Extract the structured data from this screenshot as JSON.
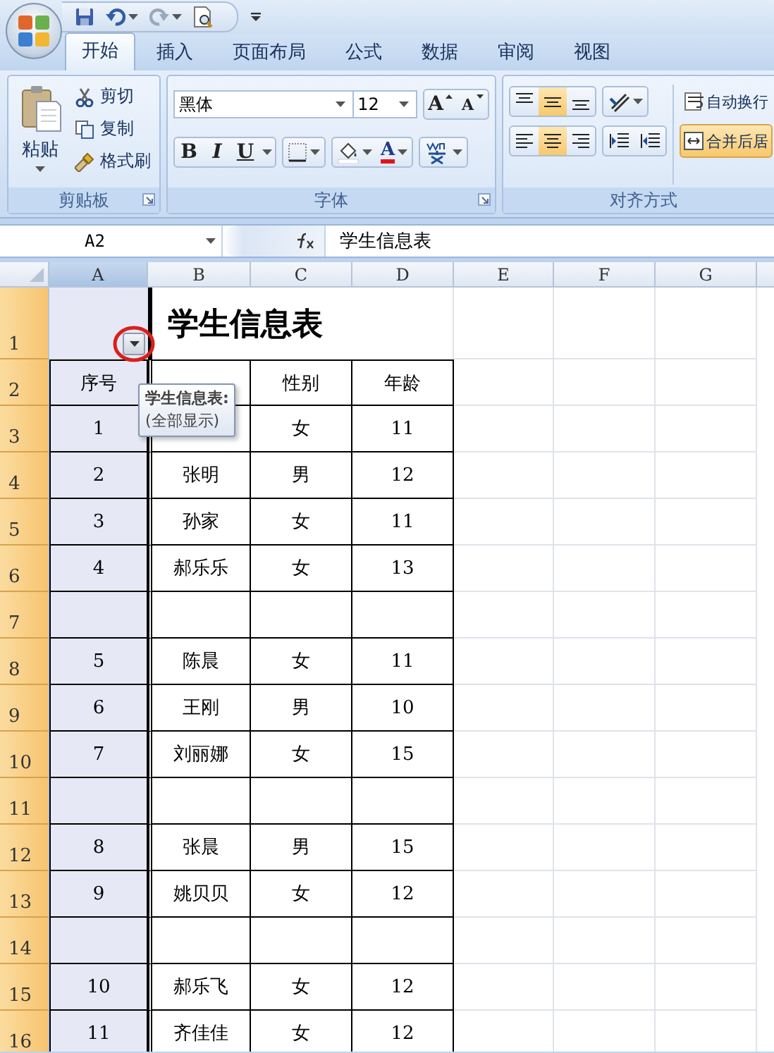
{
  "tabs": [
    {
      "label": "开始",
      "selected": true
    },
    {
      "label": "插入",
      "selected": false
    },
    {
      "label": "页面布局",
      "selected": false
    },
    {
      "label": "公式",
      "selected": false
    },
    {
      "label": "数据",
      "selected": false
    },
    {
      "label": "审阅",
      "selected": false
    },
    {
      "label": "视图",
      "selected": false
    }
  ],
  "clipboard": {
    "label": "剪贴板",
    "paste": "粘贴",
    "cut": "剪切",
    "copy": "复制",
    "format_painter": "格式刷"
  },
  "font": {
    "label": "字体",
    "font_name": "黑体",
    "font_size": "12",
    "grow": "A",
    "shrink": "A",
    "bold": "B",
    "italic": "I",
    "underline": "U",
    "font_color": "A"
  },
  "alignment": {
    "label": "对齐方式",
    "row1": [
      {
        "kind": "top",
        "selected": false
      },
      {
        "kind": "middle",
        "selected": true
      },
      {
        "kind": "bottom",
        "selected": false
      }
    ],
    "row2": [
      {
        "kind": "left",
        "selected": false
      },
      {
        "kind": "center",
        "selected": true
      },
      {
        "kind": "right",
        "selected": false
      }
    ],
    "wrap": {
      "label": "自动换行",
      "selected": false
    },
    "merge": {
      "label": "合并后居",
      "selected": true
    }
  },
  "name_box": "A2",
  "formula": "学生信息表",
  "columns": [
    {
      "label": "A",
      "selected": true
    },
    {
      "label": "B",
      "selected": false
    },
    {
      "label": "C",
      "selected": false
    },
    {
      "label": "D",
      "selected": false
    },
    {
      "label": "E",
      "selected": false
    },
    {
      "label": "F",
      "selected": false
    },
    {
      "label": "G",
      "selected": false
    }
  ],
  "rows": [
    {
      "number": "1",
      "selected": true,
      "kind": "title",
      "title": "学生信息表"
    },
    {
      "number": "2",
      "selected": true,
      "kind": "data",
      "cells": {
        "A": "序号",
        "C": "性别",
        "D": "年龄"
      }
    },
    {
      "number": "3",
      "selected": true,
      "kind": "data",
      "cells": {
        "A": "1",
        "C": "女",
        "D": "11"
      }
    },
    {
      "number": "4",
      "selected": true,
      "kind": "data",
      "cells": {
        "A": "2",
        "B": "张明",
        "C": "男",
        "D": "12"
      }
    },
    {
      "number": "5",
      "selected": true,
      "kind": "data",
      "cells": {
        "A": "3",
        "B": "孙家",
        "C": "女",
        "D": "11"
      }
    },
    {
      "number": "6",
      "selected": true,
      "kind": "data",
      "cells": {
        "A": "4",
        "B": "郝乐乐",
        "C": "女",
        "D": "13"
      }
    },
    {
      "number": "7",
      "selected": true,
      "kind": "data",
      "cells": {}
    },
    {
      "number": "8",
      "selected": true,
      "kind": "data",
      "cells": {
        "A": "5",
        "B": "陈晨",
        "C": "女",
        "D": "11"
      }
    },
    {
      "number": "9",
      "selected": true,
      "kind": "data",
      "cells": {
        "A": "6",
        "B": "王刚",
        "C": "男",
        "D": "10"
      }
    },
    {
      "number": "10",
      "selected": true,
      "kind": "data",
      "cells": {
        "A": "7",
        "B": "刘丽娜",
        "C": "女",
        "D": "15"
      }
    },
    {
      "number": "11",
      "selected": true,
      "kind": "data",
      "cells": {}
    },
    {
      "number": "12",
      "selected": true,
      "kind": "data",
      "cells": {
        "A": "8",
        "B": "张晨",
        "C": "男",
        "D": "15"
      }
    },
    {
      "number": "13",
      "selected": true,
      "kind": "data",
      "cells": {
        "A": "9",
        "B": "姚贝贝",
        "C": "女",
        "D": "12"
      }
    },
    {
      "number": "14",
      "selected": true,
      "kind": "data",
      "cells": {}
    },
    {
      "number": "15",
      "selected": true,
      "kind": "data",
      "cells": {
        "A": "10",
        "B": "郝乐飞",
        "C": "女",
        "D": "12"
      }
    },
    {
      "number": "16",
      "selected": true,
      "kind": "data",
      "cells": {
        "A": "11",
        "B": "齐佳佳",
        "C": "女",
        "D": "12"
      }
    }
  ],
  "tooltip": {
    "lines": [
      "学生信息表:",
      "(全部显示)"
    ]
  }
}
